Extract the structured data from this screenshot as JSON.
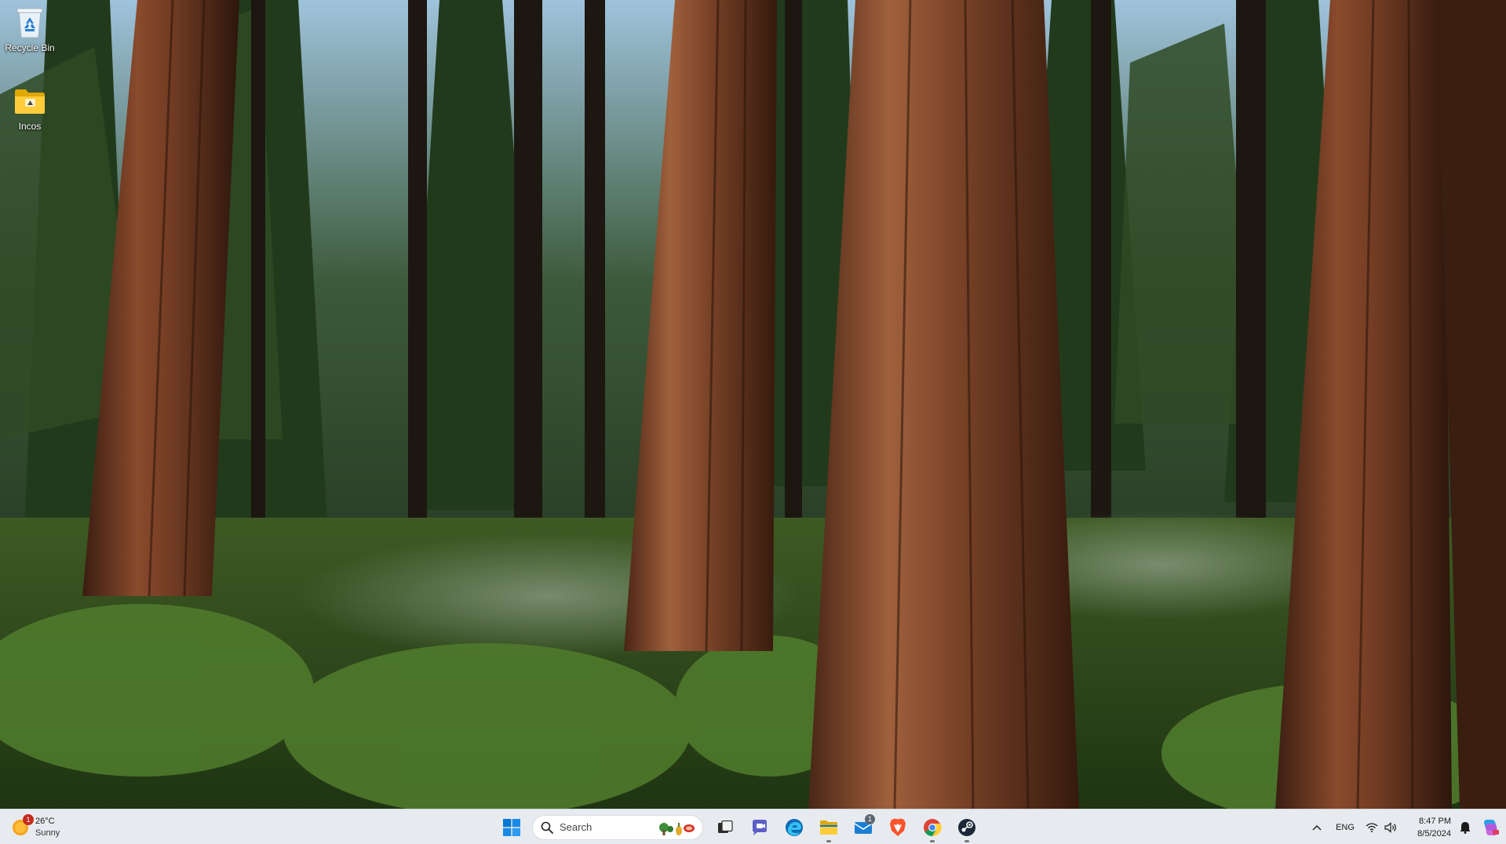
{
  "desktop": {
    "icons": [
      {
        "label": "Recycle Bin",
        "icon": "recycle-bin-icon"
      },
      {
        "label": "Incos",
        "icon": "folder-icon"
      }
    ]
  },
  "taskbar": {
    "weather": {
      "temperature": "26°C",
      "condition": "Sunny",
      "badge": "1",
      "icon": "sun-icon"
    },
    "start": {
      "icon": "windows-start-icon"
    },
    "search": {
      "placeholder": "Search",
      "icon": "search-icon"
    },
    "apps": [
      {
        "name": "task-view",
        "icon": "task-view-icon"
      },
      {
        "name": "teams",
        "icon": "teams-chat-icon"
      },
      {
        "name": "edge",
        "icon": "edge-icon"
      },
      {
        "name": "file-explorer",
        "icon": "folder-icon",
        "running": true
      },
      {
        "name": "mail",
        "icon": "mail-icon",
        "badge": "1"
      },
      {
        "name": "brave",
        "icon": "brave-icon"
      },
      {
        "name": "chrome",
        "icon": "chrome-icon",
        "running": true
      },
      {
        "name": "steam",
        "icon": "steam-icon",
        "running": true
      }
    ],
    "tray": {
      "language": "ENG",
      "time": "8:47 PM",
      "date": "8/5/2024",
      "icons": [
        "chevron-up-icon",
        "wifi-icon",
        "speaker-icon",
        "bell-icon",
        "copilot-icon"
      ]
    }
  },
  "colors": {
    "taskbar_bg": "#e7ebef",
    "accent": "#0078d4"
  }
}
